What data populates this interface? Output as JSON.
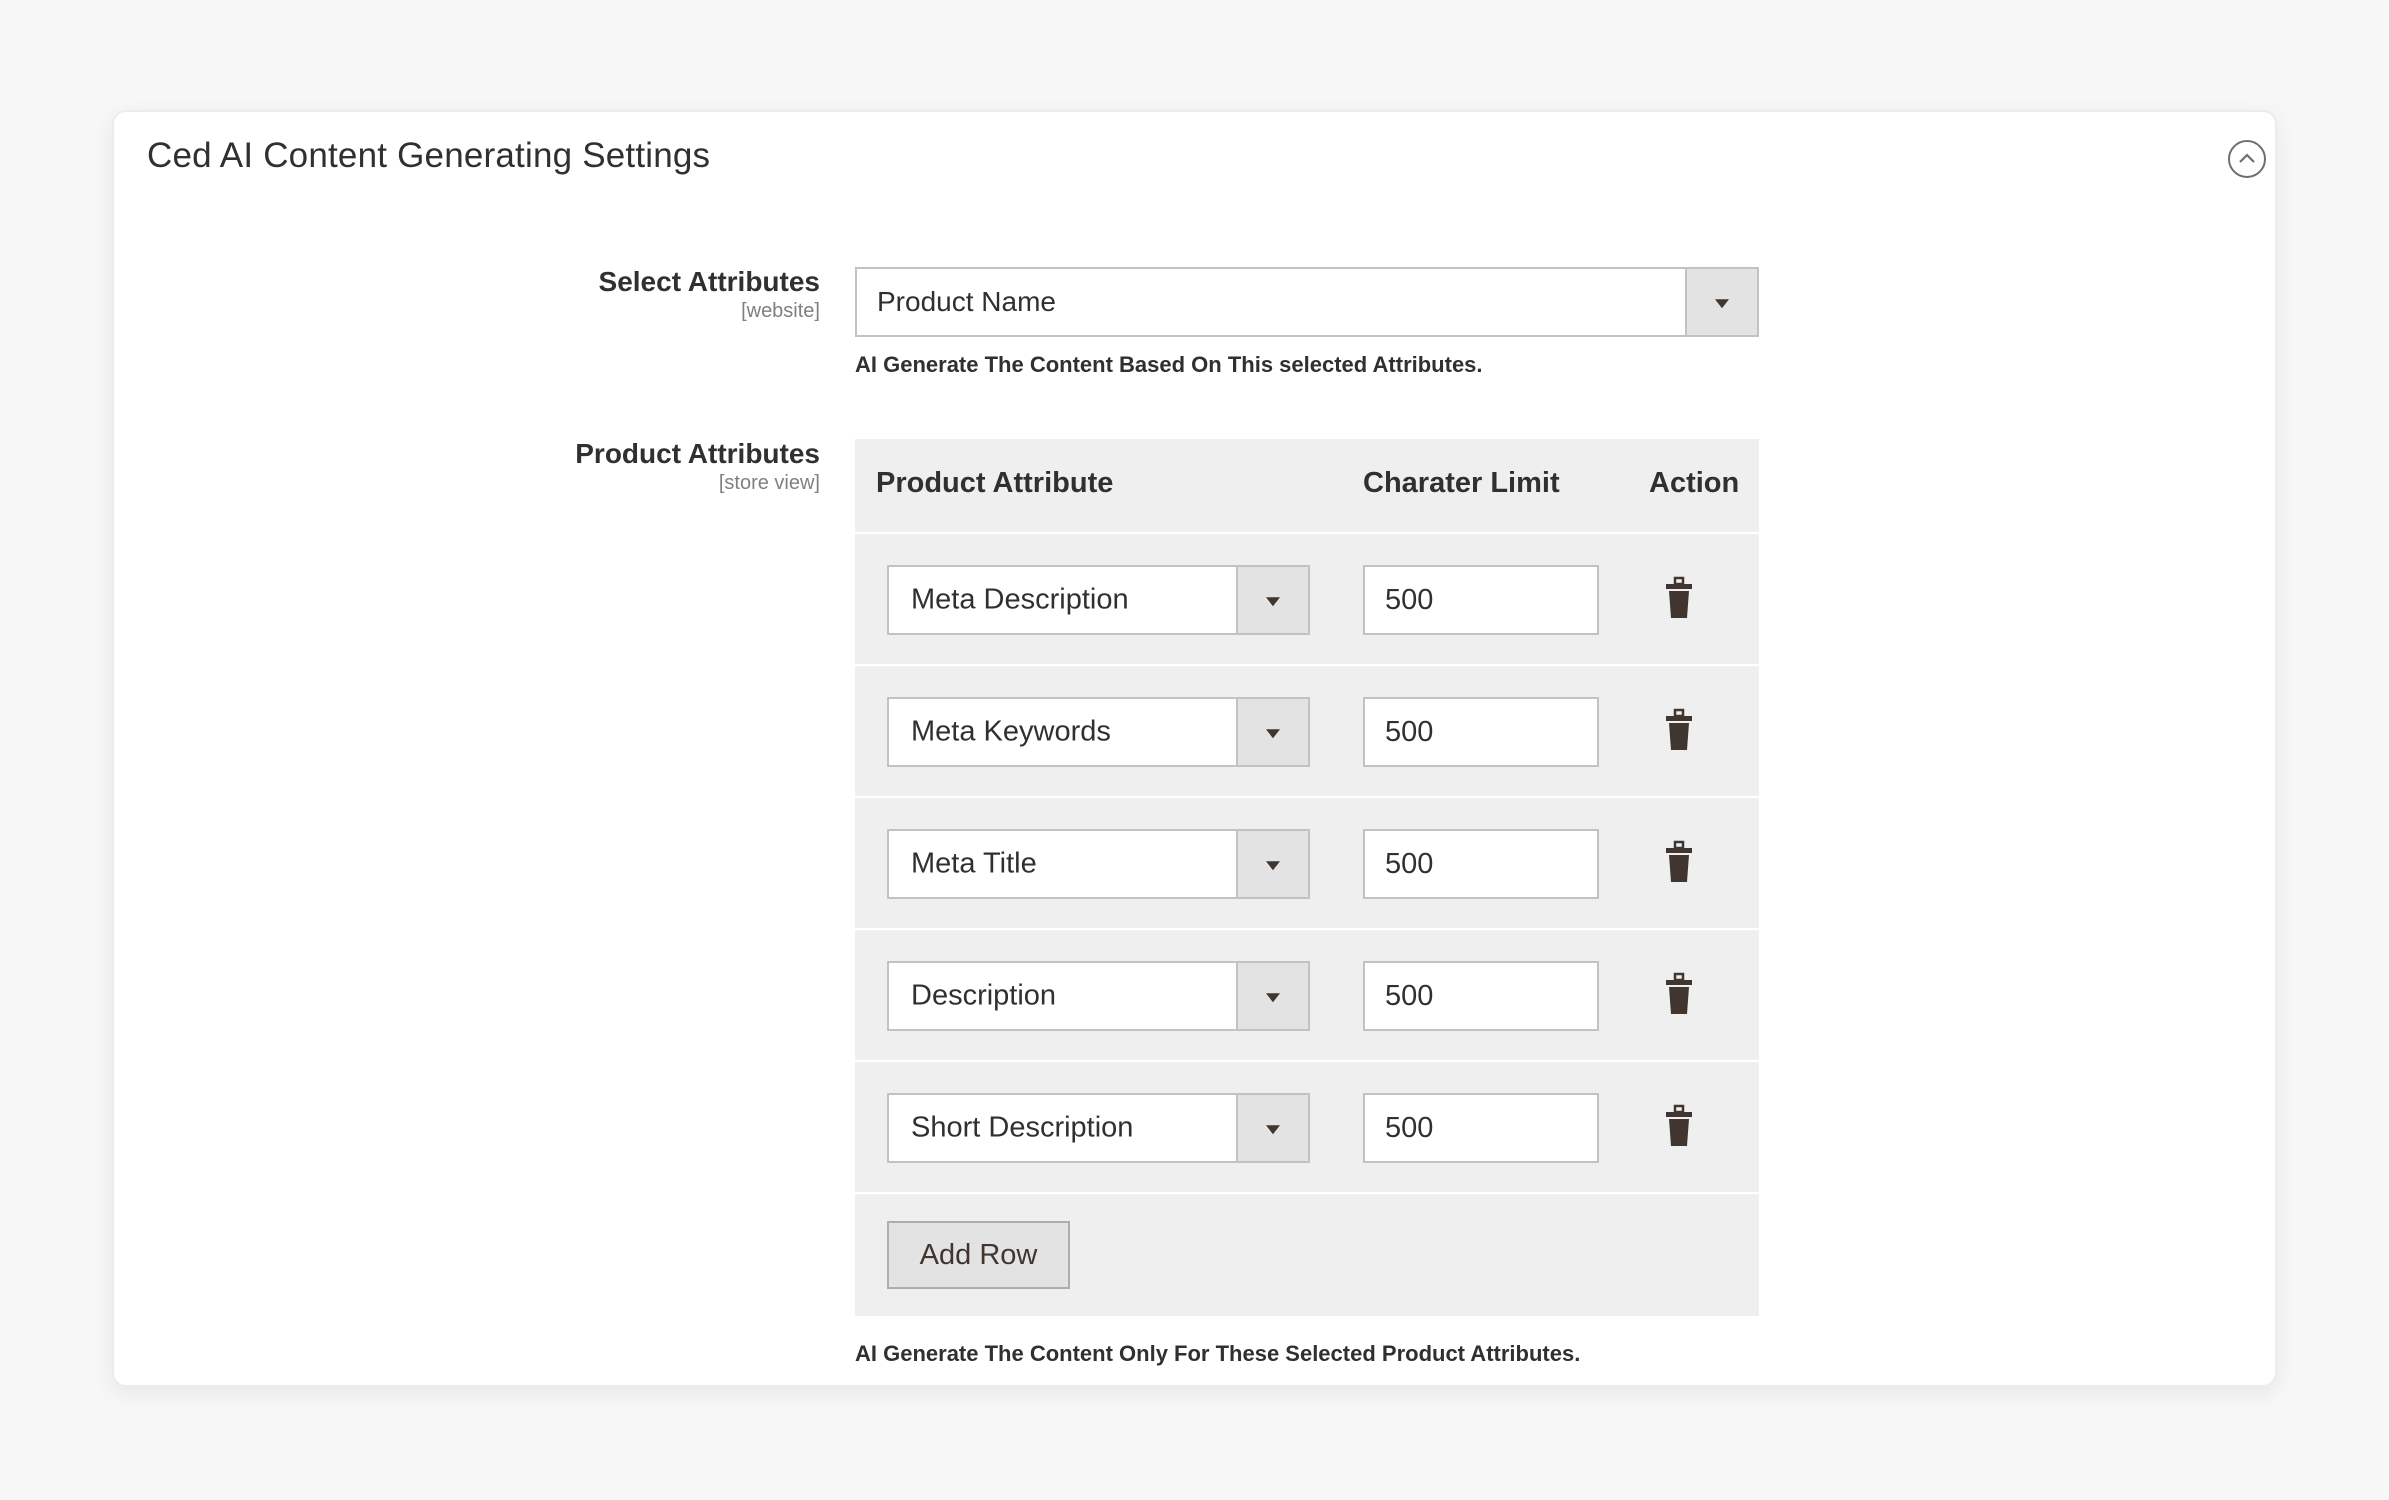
{
  "panel": {
    "title": "Ced AI Content Generating Settings",
    "collapse_icon": "chevron-up-circle-icon"
  },
  "select_attributes": {
    "label": "Select Attributes",
    "scope": "[website]",
    "value": "Product Name",
    "note": "AI Generate The Content Based On This selected Attributes."
  },
  "product_attributes": {
    "label": "Product Attributes",
    "scope": "[store view]",
    "columns": [
      "Product Attribute",
      "Charater Limit",
      "Action"
    ],
    "rows": [
      {
        "attribute": "Meta Description",
        "limit": "500"
      },
      {
        "attribute": "Meta Keywords",
        "limit": "500"
      },
      {
        "attribute": "Meta Title",
        "limit": "500"
      },
      {
        "attribute": "Description",
        "limit": "500"
      },
      {
        "attribute": "Short Description",
        "limit": "500"
      }
    ],
    "add_row_label": "Add Row",
    "delete_icon": "trash-icon",
    "note": "AI Generate The Content Only For These Selected Product Attributes."
  }
}
